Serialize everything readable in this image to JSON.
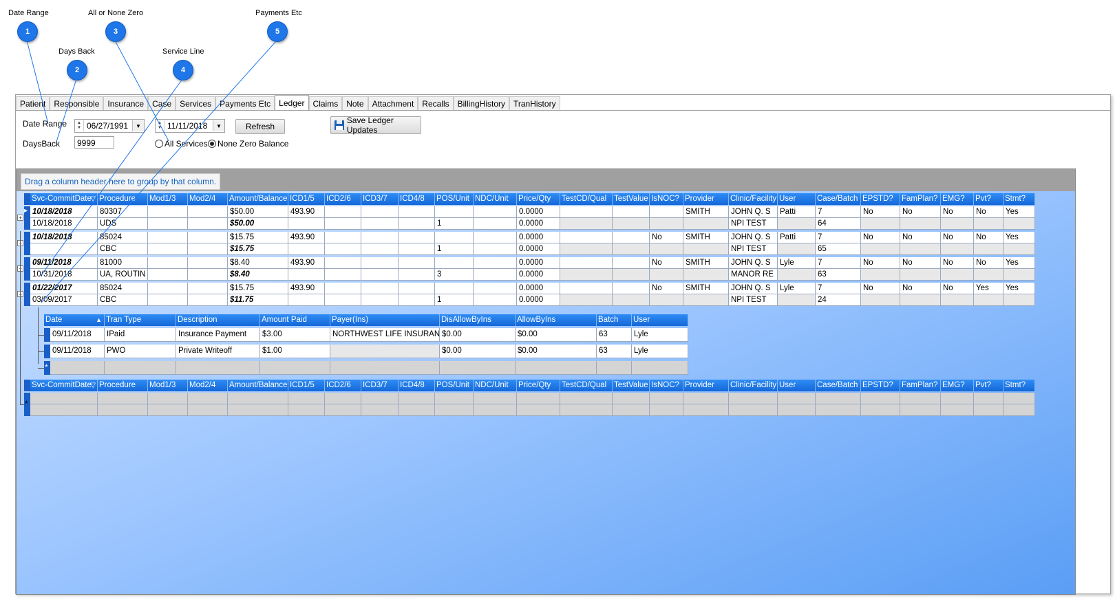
{
  "callouts": [
    {
      "num": "1",
      "label": "Date Range"
    },
    {
      "num": "2",
      "label": "Days Back"
    },
    {
      "num": "3",
      "label": "All or None Zero"
    },
    {
      "num": "4",
      "label": "Service Line"
    },
    {
      "num": "5",
      "label": "Payments Etc"
    }
  ],
  "tabs": [
    "Patient",
    "Responsible",
    "Insurance",
    "Case",
    "Services",
    "Payments Etc",
    "Ledger",
    "Claims",
    "Note",
    "Attachment",
    "Recalls",
    "BillingHistory",
    "TranHistory"
  ],
  "active_tab": "Ledger",
  "controls": {
    "date_range_label": "Date Range",
    "date_from": "06/27/1991",
    "date_to": "11/11/2018",
    "refresh_label": "Refresh",
    "save_label": "Save Ledger Updates",
    "days_back_label": "DaysBack",
    "days_back_value": "9999",
    "radio_all": "All Services",
    "radio_none_zero": "None Zero Balance",
    "selected_radio": "None Zero Balance"
  },
  "group_hint": "Drag a column header here to group by that column.",
  "service_columns": [
    "Svc-CommitDate",
    "Procedure",
    "Mod1/3",
    "Mod2/4",
    "Amount/Balance",
    "ICD1/5",
    "ICD2/6",
    "ICD3/7",
    "ICD4/8",
    "POS/Unit",
    "NDC/Unit",
    "Price/Qty",
    "TestCD/Qual",
    "TestValue",
    "IsNOC?",
    "Provider",
    "Clinic/Facility",
    "User",
    "Case/Batch",
    "EPSTD?",
    "FamPlan?",
    "EMG?",
    "Pvt?",
    "Stmt?"
  ],
  "services": [
    {
      "row1": [
        "10/18/2018",
        "80307",
        "",
        "",
        "$50.00",
        "493.90",
        "",
        "",
        "",
        "",
        "",
        "0.0000",
        "",
        "",
        "",
        "SMITH",
        "JOHN Q. S",
        "Patti",
        "7",
        "No",
        "No",
        "No",
        "No",
        "Yes"
      ],
      "row2": [
        "10/18/2018",
        "UDS",
        "",
        "",
        "$50.00",
        "",
        "",
        "",
        "",
        "1",
        "",
        "0.0000",
        "",
        "",
        "",
        "",
        "NPI TEST",
        "",
        "64",
        "",
        "",
        "",
        "",
        ""
      ],
      "expanded": false
    },
    {
      "row1": [
        "10/18/2018",
        "85024",
        "",
        "",
        "$15.75",
        "493.90",
        "",
        "",
        "",
        "",
        "",
        "0.0000",
        "",
        "",
        "No",
        "SMITH",
        "JOHN Q. S",
        "Patti",
        "7",
        "No",
        "No",
        "No",
        "No",
        "Yes"
      ],
      "row2": [
        "",
        "CBC",
        "",
        "",
        "$15.75",
        "",
        "",
        "",
        "",
        "1",
        "",
        "0.0000",
        "",
        "",
        "",
        "",
        "NPI TEST",
        "",
        "65",
        "",
        "",
        "",
        "",
        ""
      ],
      "expanded": false
    },
    {
      "row1": [
        "09/11/2018",
        "81000",
        "",
        "",
        "$8.40",
        "493.90",
        "",
        "",
        "",
        "",
        "",
        "0.0000",
        "",
        "",
        "No",
        "SMITH",
        "JOHN Q. S",
        "Lyle",
        "7",
        "No",
        "No",
        "No",
        "No",
        "Yes"
      ],
      "row2": [
        "10/31/2018",
        "UA, ROUTIN",
        "",
        "",
        "$8.40",
        "",
        "",
        "",
        "",
        "3",
        "",
        "0.0000",
        "",
        "",
        "",
        "",
        "MANOR RE",
        "",
        "63",
        "",
        "",
        "",
        "",
        ""
      ],
      "expanded": false
    },
    {
      "row1": [
        "01/22/2017",
        "85024",
        "",
        "",
        "$15.75",
        "493.90",
        "",
        "",
        "",
        "",
        "",
        "0.0000",
        "",
        "",
        "No",
        "SMITH",
        "JOHN Q. S",
        "Lyle",
        "7",
        "No",
        "No",
        "No",
        "Yes",
        "Yes"
      ],
      "row2": [
        "03/09/2017",
        "CBC",
        "",
        "",
        "$11.75",
        "",
        "",
        "",
        "",
        "1",
        "",
        "0.0000",
        "",
        "",
        "",
        "",
        "NPI TEST",
        "",
        "24",
        "",
        "",
        "",
        "",
        ""
      ],
      "expanded": true
    }
  ],
  "payment_columns": [
    "Date",
    "Tran Type",
    "Description",
    "Amount Paid",
    "Payer(Ins)",
    "DisAllowByIns",
    "AllowByIns",
    "Batch",
    "User"
  ],
  "payments": [
    [
      "09/11/2018",
      "IPaid",
      "Insurance Payment",
      "$3.00",
      "NORTHWEST LIFE INSURAN",
      "$0.00",
      "$0.00",
      "63",
      "Lyle"
    ],
    [
      "09/11/2018",
      "PWO",
      "Private Writeoff",
      "$1.00",
      "",
      "$0.00",
      "$0.00",
      "63",
      "Lyle"
    ]
  ],
  "glyphs": {
    "new_row": "*",
    "plus": "+",
    "minus": "−",
    "sort_asc": "▲",
    "filter": "▽",
    "row_pointer": "▸"
  }
}
